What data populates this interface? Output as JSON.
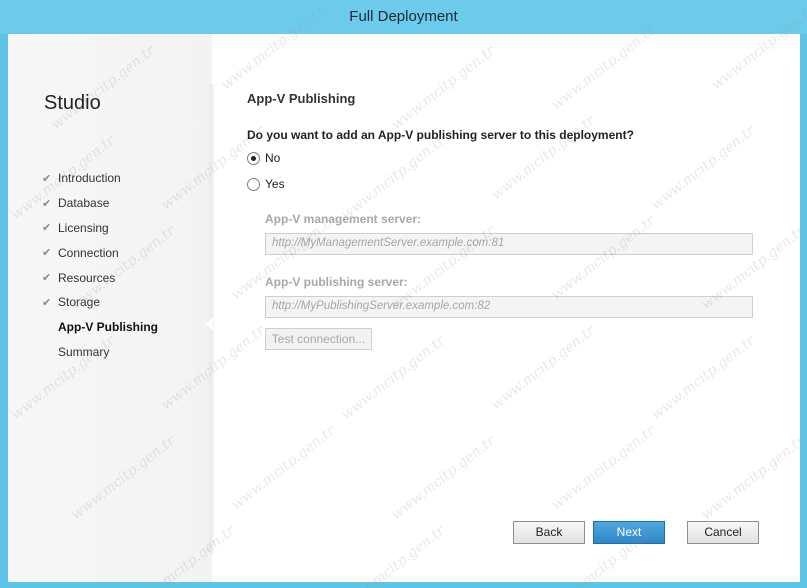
{
  "window": {
    "title": "Full Deployment"
  },
  "sidebar": {
    "heading": "Studio",
    "steps": [
      {
        "label": "Introduction",
        "done": true
      },
      {
        "label": "Database",
        "done": true
      },
      {
        "label": "Licensing",
        "done": true
      },
      {
        "label": "Connection",
        "done": true
      },
      {
        "label": "Resources",
        "done": true
      },
      {
        "label": "Storage",
        "done": true
      },
      {
        "label": "App-V Publishing",
        "done": false,
        "current": true
      },
      {
        "label": "Summary",
        "done": false
      }
    ]
  },
  "page": {
    "title": "App-V Publishing",
    "question": "Do you want to add an App-V publishing server to this deployment?",
    "options": [
      {
        "label": "No",
        "selected": true
      },
      {
        "label": "Yes",
        "selected": false
      }
    ],
    "management_label": "App-V management server:",
    "management_placeholder": "http://MyManagementServer.example.com:81",
    "publishing_label": "App-V publishing server:",
    "publishing_placeholder": "http://MyPublishingServer.example.com:82",
    "test_button": "Test connection..."
  },
  "footer": {
    "back": "Back",
    "next": "Next",
    "cancel": "Cancel"
  },
  "watermark": "www.mcitp.gen.tr",
  "colors": {
    "titlebar": "#6ccbeb",
    "primary_button": "#2f86c6"
  },
  "icons": {
    "step_done": "check-icon"
  }
}
